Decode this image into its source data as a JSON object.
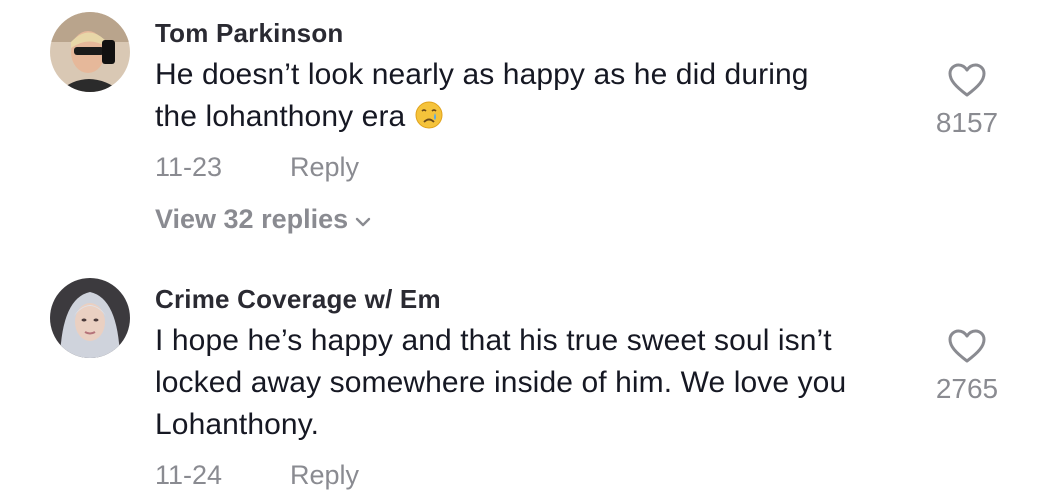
{
  "comments": [
    {
      "username": "Tom Parkinson",
      "text_line1": "He doesn’t look nearly as happy as he did during",
      "text_line2": "the lohanthony era",
      "emoji": "crying-face",
      "date": "11-23",
      "reply_label": "Reply",
      "like_count": "8157",
      "view_replies_label": "View 32 replies"
    },
    {
      "username": "Crime Coverage w/ Em",
      "text_line1": "I hope he’s happy and that his true sweet soul isn’t",
      "text_line2": "locked away somewhere inside of him. We love you",
      "text_line3": "Lohanthony.",
      "date": "11-24",
      "reply_label": "Reply",
      "like_count": "2765"
    }
  ],
  "colors": {
    "primary_text": "#161823",
    "secondary_text": "#8a8b91"
  }
}
